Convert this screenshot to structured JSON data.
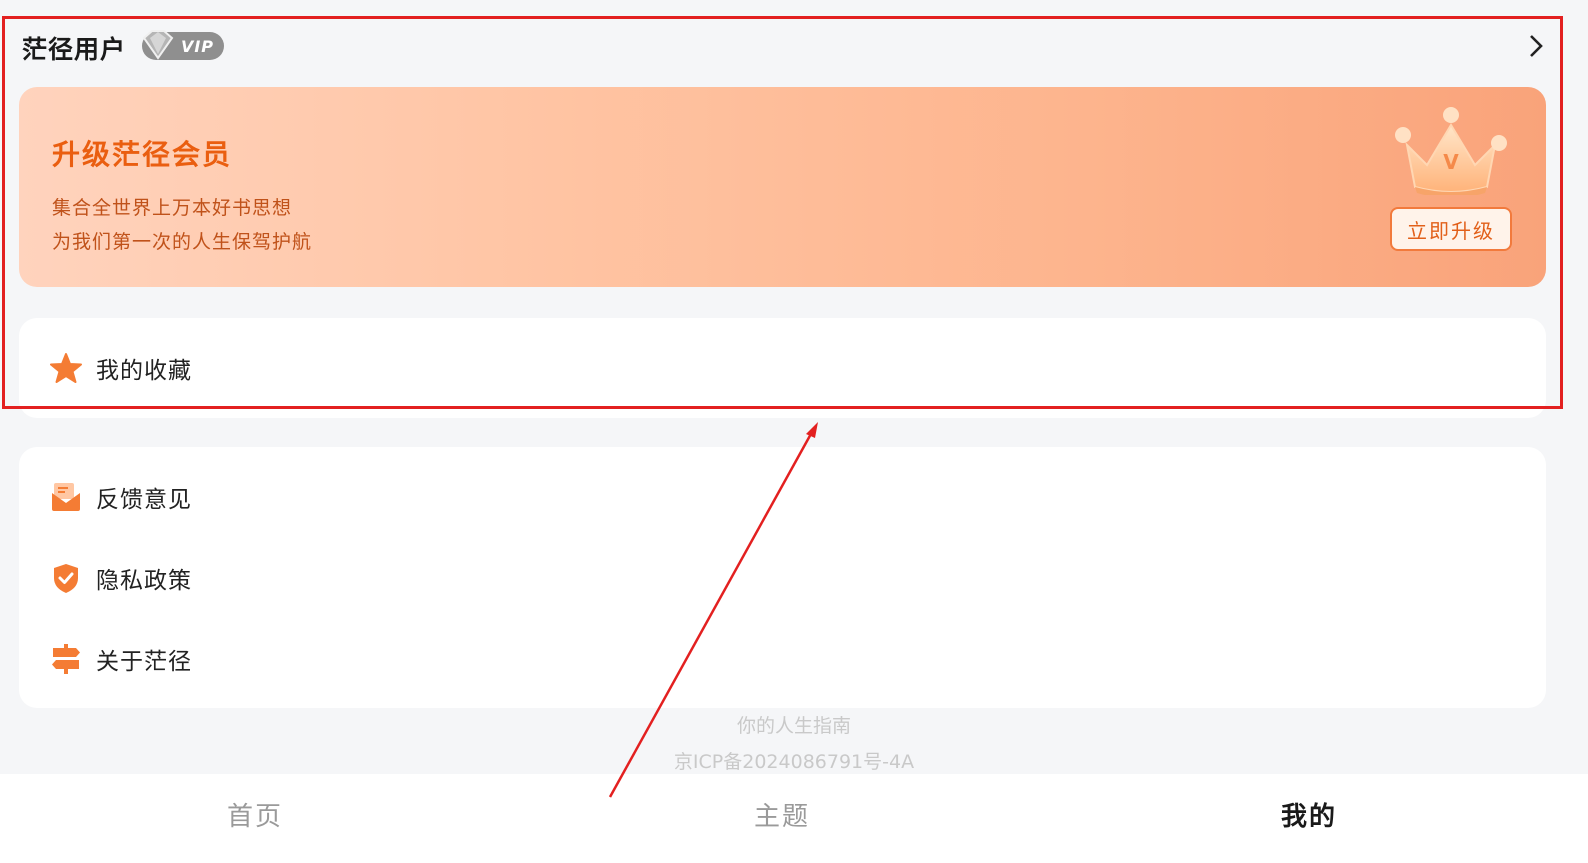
{
  "header": {
    "username": "茫径用户",
    "vip_label": "VIP"
  },
  "banner": {
    "title": "升级茫径会员",
    "line1": "集合全世界上万本好书思想",
    "line2": "为我们第一次的人生保驾护航",
    "button": "立即升级",
    "crown_letter": "V"
  },
  "favorites": {
    "label": "我的收藏",
    "icon": "star-icon"
  },
  "menu": {
    "items": [
      {
        "label": "反馈意见",
        "icon": "mail-icon"
      },
      {
        "label": "隐私政策",
        "icon": "shield-check-icon"
      },
      {
        "label": "关于茫径",
        "icon": "signpost-icon"
      }
    ]
  },
  "footer": {
    "slogan": "你的人生指南",
    "icp": "京ICP备2024086791号-4A"
  },
  "tabs": [
    {
      "label": "首页",
      "active": false
    },
    {
      "label": "主题",
      "active": false
    },
    {
      "label": "我的",
      "active": true
    }
  ],
  "colors": {
    "accent": "#ea5e10",
    "icon_orange": "#f47c34",
    "annotation_red": "#e32020",
    "page_bg": "#f5f6f8"
  }
}
